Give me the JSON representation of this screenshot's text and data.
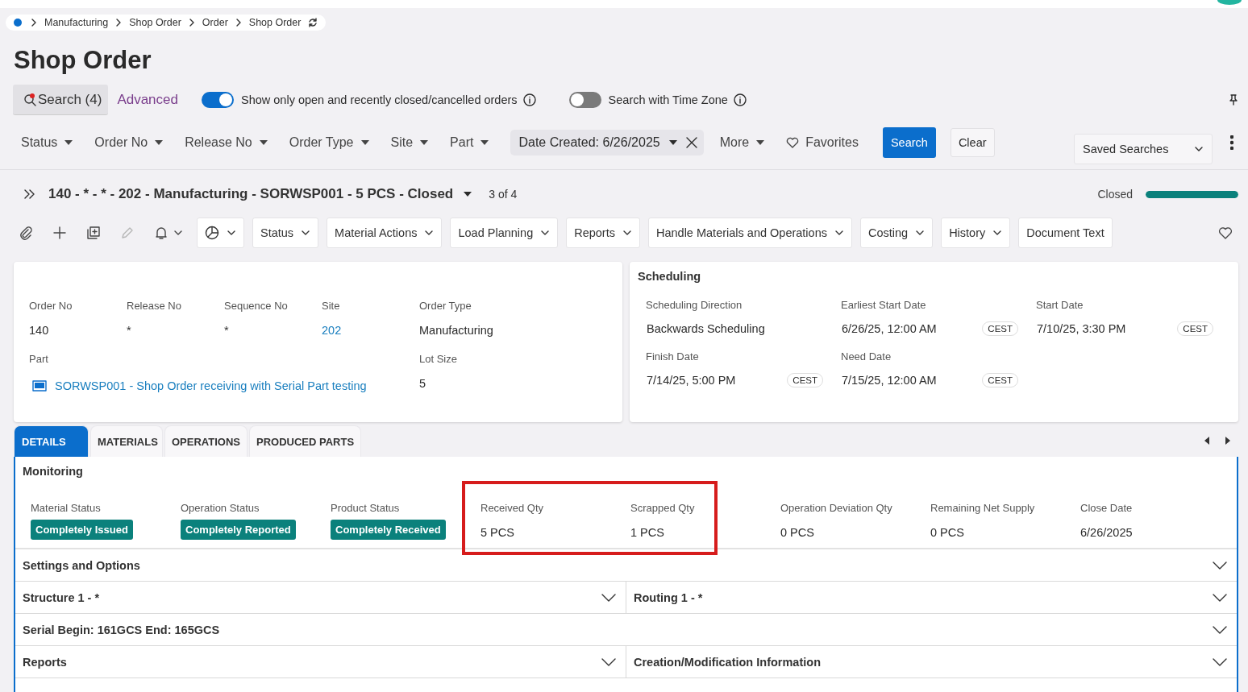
{
  "breadcrumb": [
    "Manufacturing",
    "Shop Order",
    "Order",
    "Shop Order"
  ],
  "page_title": "Shop Order",
  "search_bar": {
    "search_tab": "Search (4)",
    "advanced_tab": "Advanced",
    "toggles": [
      {
        "label": "Show only open and recently closed/cancelled orders",
        "on": true
      },
      {
        "label": "Search with Time Zone",
        "on": false
      }
    ]
  },
  "filters": [
    {
      "label": "Status"
    },
    {
      "label": "Order No"
    },
    {
      "label": "Release No"
    },
    {
      "label": "Order Type"
    },
    {
      "label": "Site"
    },
    {
      "label": "Part"
    }
  ],
  "date_filter": "Date Created: 6/26/2025",
  "more": "More",
  "favorites": "Favorites",
  "search_button": "Search",
  "clear_button": "Clear",
  "saved_searches": "Saved Searches",
  "record": {
    "title": "140 - * - * - 202 - Manufacturing - SORWSP001 - 5 PCS - Closed",
    "counter": "3 of 4",
    "status": "Closed",
    "level": 1
  },
  "toolbar_menus": [
    {
      "label": "Status",
      "kind": "menu"
    },
    {
      "label": "Material Actions",
      "kind": "menu"
    },
    {
      "label": "Load Planning",
      "kind": "menu"
    },
    {
      "label": "Reports",
      "kind": "menu"
    },
    {
      "label": "Handle Materials and Operations",
      "kind": "menu"
    },
    {
      "label": "Costing",
      "kind": "menu"
    },
    {
      "label": "History",
      "kind": "menu"
    },
    {
      "label": "Document Text",
      "kind": "button"
    }
  ],
  "header_card": {
    "fields": [
      {
        "label": "Order No",
        "value": "140",
        "kind": "text"
      },
      {
        "label": "Release No",
        "value": "*",
        "kind": "text"
      },
      {
        "label": "Sequence No",
        "value": "*",
        "kind": "text"
      },
      {
        "label": "Site",
        "value": "202",
        "kind": "link"
      },
      {
        "label": "Order Type",
        "value": "Manufacturing",
        "kind": "text"
      },
      {
        "label": "Part",
        "value": "SORWSP001 - Shop Order receiving with Serial Part testing",
        "kind": "part"
      },
      {
        "label": "Lot Size",
        "value": "5",
        "kind": "text"
      }
    ]
  },
  "scheduling": {
    "title": "Scheduling",
    "fields": [
      {
        "label": "Scheduling Direction",
        "value": "Backwards Scheduling"
      },
      {
        "label": "Earliest Start Date",
        "value": "6/26/25, 12:00 AM",
        "time_zone": "CEST"
      },
      {
        "label": "Start Date",
        "value": "7/10/25, 3:30 PM",
        "time_zone": "CEST"
      },
      {
        "label": "Finish Date",
        "value": "7/14/25, 5:00 PM",
        "time_zone": "CEST"
      },
      {
        "label": "Need Date",
        "value": "7/15/25, 12:00 AM",
        "time_zone": "CEST"
      }
    ]
  },
  "tabs": [
    {
      "label": "DETAILS",
      "selected": true
    },
    {
      "label": "MATERIALS",
      "selected": false
    },
    {
      "label": "OPERATIONS",
      "selected": false
    },
    {
      "label": "PRODUCED PARTS",
      "selected": false
    }
  ],
  "monitoring": {
    "title": "Monitoring",
    "fields": [
      {
        "label": "Material Status",
        "value": "Completely Issued",
        "kind": "badge",
        "highlighted": false
      },
      {
        "label": "Operation Status",
        "value": "Completely Reported",
        "kind": "badge",
        "highlighted": false
      },
      {
        "label": "Product Status",
        "value": "Completely Received",
        "kind": "badge",
        "highlighted": false
      },
      {
        "label": "Received Qty",
        "value": "5 PCS",
        "kind": "text",
        "highlighted": true
      },
      {
        "label": "Scrapped Qty",
        "value": "1 PCS",
        "kind": "text",
        "highlighted": true
      },
      {
        "label": "Operation Deviation Qty",
        "value": "0 PCS",
        "kind": "text",
        "highlighted": false
      },
      {
        "label": "Remaining Net Supply",
        "value": "0 PCS",
        "kind": "text",
        "highlighted": false
      },
      {
        "label": "Close Date",
        "value": "6/26/2025",
        "kind": "text",
        "highlighted": false
      }
    ]
  },
  "sections": [
    {
      "panels": [
        {
          "title": "Settings and Options"
        }
      ]
    },
    {
      "panels": [
        {
          "title": "Structure 1 - *"
        },
        {
          "title": "Routing 1 - *"
        }
      ]
    },
    {
      "panels": [
        {
          "title": "Serial Begin: 161GCS End: 165GCS"
        }
      ]
    },
    {
      "panels": [
        {
          "title": "Reports"
        },
        {
          "title": "Creation/Modification Information"
        }
      ]
    }
  ]
}
